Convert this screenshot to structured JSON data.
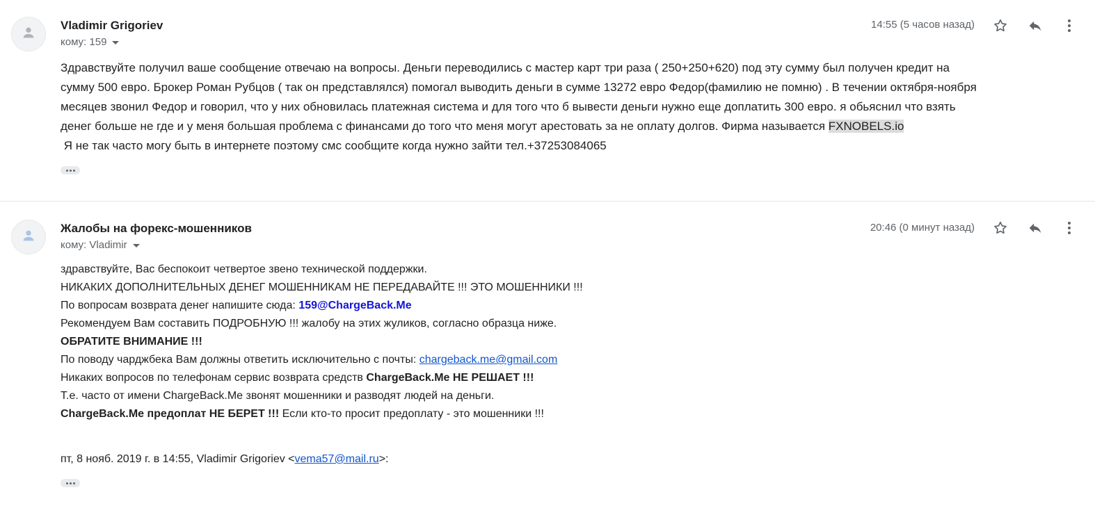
{
  "message1": {
    "sender": "Vladimir Grigoriev",
    "to_label": "кому: 159",
    "time": "14:55 (5 часов назад)",
    "lines": [
      "Здравствуйте получил ваше сообщение отвечаю на вопросы. Деньги  переводились с мастер карт три раза ( 250+250+620) под эту сумму был получен кредит на",
      "сумму 500 евро. Брокер Роман Рубцов ( так он представлялся) помогал выводить деньги в сумме 13272 евро Федор(фамилию не помню) . В течении октября-ноября",
      "месяцев звонил Федор и говорил, что у них обновилась платежная система и для того что б вывести деньги нужно еще доплатить 300 евро. я обьяснил что взять",
      "денег больше не где и у меня большая проблема с финансами  до того что меня могут арестовать за не оплату долгов. Фирма называется ",
      " Я не так часто могу быть в интернете поэтому смс сообщите когда нужно зайти тел.+37253084065"
    ],
    "highlight": "FXNOBELS.io"
  },
  "message2": {
    "sender": "Жалобы на форекс-мошенников",
    "to_label": "кому: Vladimir",
    "time": "20:46 (0 минут назад)",
    "l1": "здравствуйте, Вас беспокоит четвертое звено технической поддержки.",
    "l2": "НИКАКИХ ДОПОЛНИТЕЛЬНЫХ ДЕНЕГ МОШЕННИКАМ НЕ ПЕРЕДАВАЙТЕ !!! ЭТО МОШЕННИКИ !!!",
    "l3_text": "По вопросам возврата денег напишите сюда: ",
    "l3_link": "159@ChargeBack.Me",
    "l4": "Рекомендуем Вам составить ПОДРОБНУЮ !!! жалобу на этих жуликов, согласно образца ниже.",
    "l5": "ОБРАТИТЕ ВНИМАНИЕ !!!",
    "l6_text": "По поводу чарджбека Вам должны ответить исключительно с почты: ",
    "l6_link": "chargeback.me@gmail.com",
    "l7_text": "Никаких вопросов по телефонам сервис возврата средств ",
    "l7_bold": "ChargeBack.Me НЕ РЕШАЕТ !!!",
    "l8": "Т.е. часто от имени ChargeBack.Me звонят мошенники и разводят людей на деньги.",
    "l9_bold": "ChargeBack.Me предоплат НЕ БЕРЕТ !!!",
    "l9_text": " Если кто-то просит предоплату - это мошенники !!!",
    "quote_prefix": "пт, 8 нояб. 2019 г. в 14:55, Vladimir Grigoriev <",
    "quote_link": "vema57@mail.ru",
    "quote_suffix": ">:"
  },
  "icons": {
    "avatar": "person-icon",
    "star": "star-icon",
    "reply": "reply-icon",
    "more": "more-vertical-icon"
  },
  "colors": {
    "link": "#1155cc",
    "bold_link": "#1515d6",
    "highlight": "#dcdcdc"
  }
}
